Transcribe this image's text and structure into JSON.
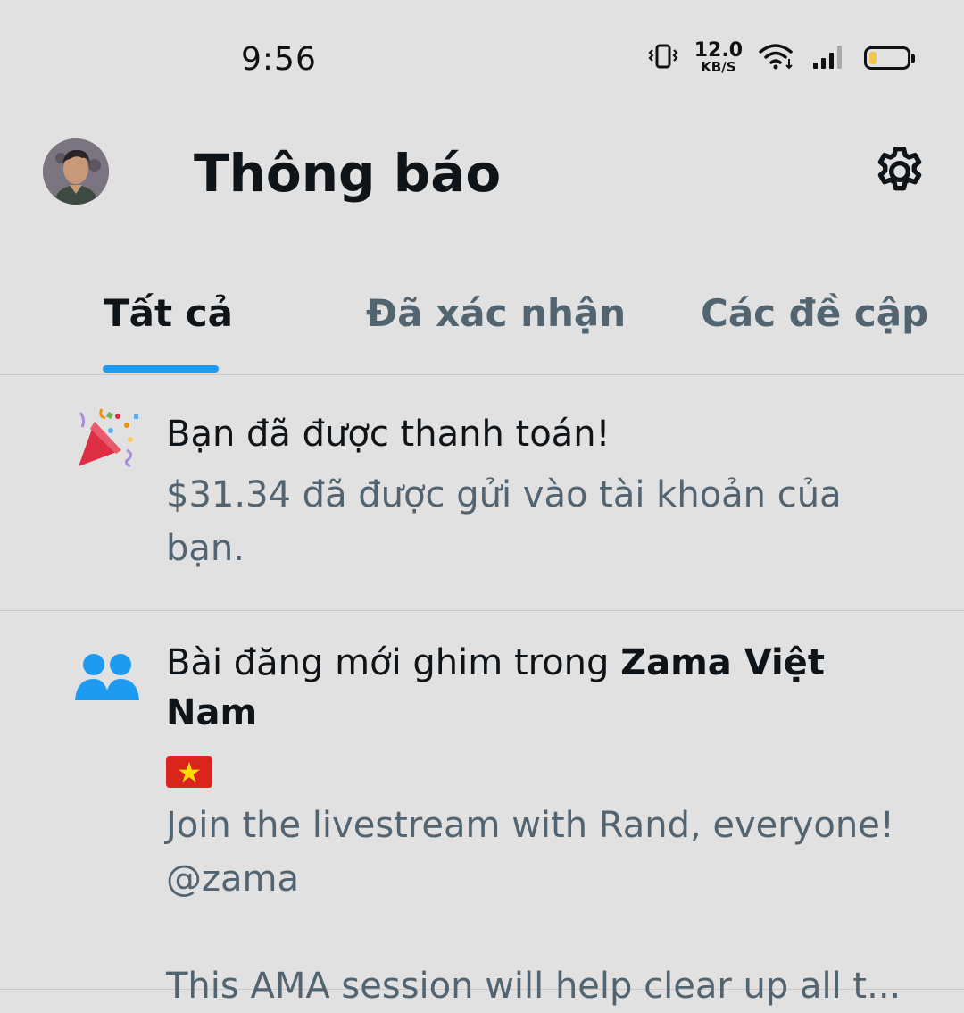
{
  "status_bar": {
    "time": "9:56",
    "net_speed_value": "12.0",
    "net_speed_unit": "KB/S",
    "battery_level": 0.2,
    "battery_color": "#f1c64b"
  },
  "header": {
    "title": "Thông báo",
    "settings_icon": "gear-icon",
    "avatar": "user-avatar"
  },
  "tabs": [
    {
      "label": "Tất cả",
      "active": true
    },
    {
      "label": "Đã xác nhận",
      "active": false
    },
    {
      "label": "Các đề cập",
      "active": false
    }
  ],
  "accent_color": "#1d9bf0",
  "notifications": [
    {
      "icon": "party-popper-icon",
      "title": "Bạn đã được thanh toán!",
      "text": "$31.34 đã được gửi vào tài khoản của bạn."
    },
    {
      "icon": "community-icon",
      "title_prefix": "Bài đăng mới ghim trong ",
      "community_name": "Zama Việt Nam",
      "flag": "vietnam-flag",
      "text_line1": "Join the livestream with Rand, everyone!",
      "text_line2": "@zama",
      "text_line3": "This AMA session will help clear up all t..."
    }
  ]
}
